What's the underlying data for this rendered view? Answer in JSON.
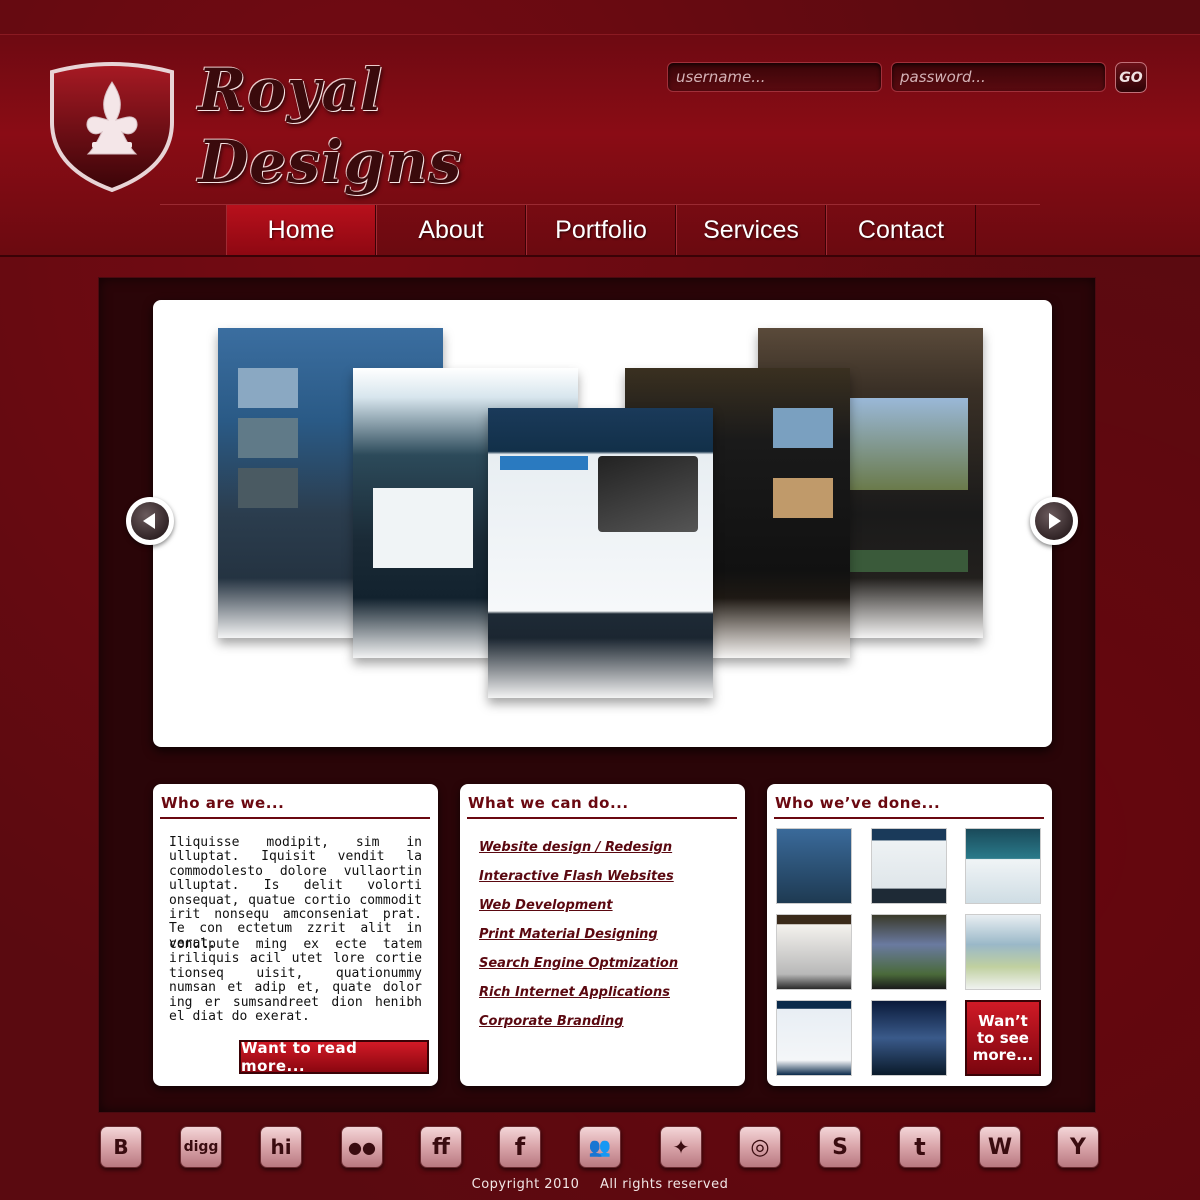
{
  "brand": {
    "line1": "Royal",
    "line2": "Designs"
  },
  "login": {
    "username_placeholder": "username...",
    "password_placeholder": "password...",
    "go_label": "GO"
  },
  "nav": {
    "items": [
      {
        "label": "Home",
        "active": true
      },
      {
        "label": "About",
        "active": false
      },
      {
        "label": "Portfolio",
        "active": false
      },
      {
        "label": "Services",
        "active": false
      },
      {
        "label": "Contact",
        "active": false
      }
    ]
  },
  "slider": {
    "prev_icon": "arrow-left-icon",
    "next_icon": "arrow-right-icon"
  },
  "who_are_we": {
    "title": "Who are we...",
    "paragraph1": "Iliquisse modipit, sim in ulluptat. Iquisit vendit la commodolesto dolore vullaortin ulluptat. Is delit volorti onsequat, quatue cortio commodit irit nonsequ amconseniat prat. Te con ectetum zzrit alit in verat.",
    "paragraph2": "conulpute ming ex ecte tatem iriliquis acil utet lore cortie tionseq uisit, quationummy numsan et adip et, quate dolor ing er sumsandreet dion henibh el diat do exerat.",
    "button": "Want to read more..."
  },
  "what_we_can_do": {
    "title": "What we can do...",
    "items": [
      "Website design / Redesign",
      "Interactive Flash Websites",
      "Web Development",
      "Print Material Designing",
      "Search Engine Optmization",
      "Rich Internet Applications",
      "Corporate Branding"
    ]
  },
  "who_weve_done": {
    "title": "Who we’ve done...",
    "see_more": "Wan’t to see more..."
  },
  "social": {
    "icons": [
      "blogger-icon",
      "digg-icon",
      "hi5-icon",
      "flickr-icon",
      "friendfeed-icon",
      "facebook-icon",
      "myspace-icon",
      "deviantart-icon",
      "rss-icon",
      "stumbleupon-icon",
      "twitter-icon",
      "wordpress-icon",
      "yahoo-icon"
    ],
    "glyphs": [
      "B",
      "digg",
      "hi",
      "●●",
      "ff",
      "f",
      "👥",
      "✦",
      "◎",
      "S",
      "t",
      "W",
      "Y"
    ]
  },
  "footer": {
    "copyright": "Copyright 2010",
    "rights": "All rights reserved"
  },
  "colors": {
    "accent": "#8a0c15",
    "nav_active": "#b8101c",
    "panel": "#2a0508",
    "link": "#5a0810"
  }
}
